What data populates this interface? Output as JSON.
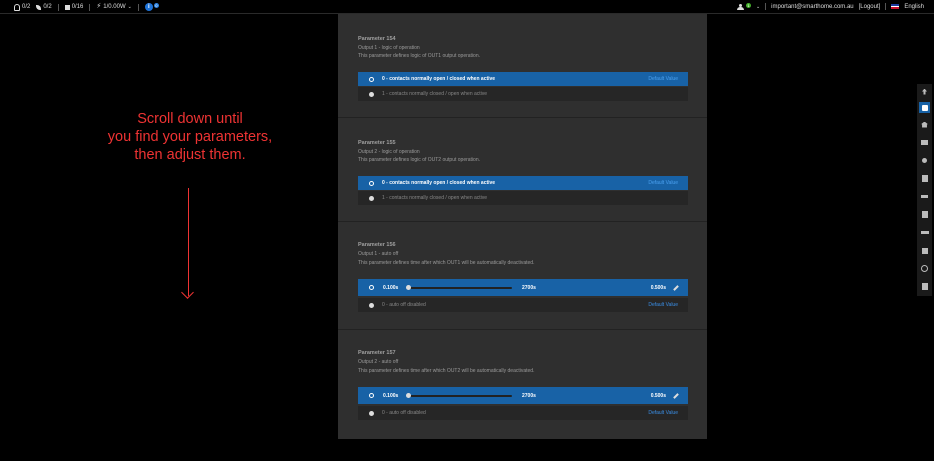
{
  "topbar": {
    "lights": "0/2",
    "plants": "0/2",
    "devices": "0/16",
    "power": "1/0.00W",
    "info_icon": "i",
    "info_badge": "0",
    "user_badge": "1",
    "email": "important@smarthome.com.au",
    "logout": "[Logout]",
    "language": "English"
  },
  "instruction": {
    "line1": "Scroll down until",
    "line2": "you find your parameters,",
    "line3": "then adjust them."
  },
  "parameters": [
    {
      "title": "Parameter 154",
      "subtitle": "Output 1 - logic of operation",
      "description": "This parameter defines logic of OUT1 output operation.",
      "selected_label": "0 - contacts normally open / closed when active",
      "default_label": "Default Value",
      "other_label": "1 - contacts normally closed / open when active"
    },
    {
      "title": "Parameter 155",
      "subtitle": "Output 2 - logic of operation",
      "description": "This parameter defines logic of OUT2 output operation.",
      "selected_label": "0 - contacts normally open / closed when active",
      "default_label": "Default Value",
      "other_label": "1 - contacts normally closed / open when active"
    },
    {
      "title": "Parameter 156",
      "subtitle": "Output 1 - auto off",
      "description": "This parameter defines time after which OUT1 will be automatically deactivated.",
      "slider_min": "0.100s",
      "slider_max": "2700s",
      "slider_value": "0.500s",
      "slider_position": 0.0,
      "other_label": "0 - auto off disabled",
      "default_label": "Default Value"
    },
    {
      "title": "Parameter 157",
      "subtitle": "Output 2 - auto off",
      "description": "This parameter defines time after which OUT2 will be automatically deactivated.",
      "slider_min": "0.100s",
      "slider_max": "2700s",
      "slider_value": "0.500s",
      "slider_position": 0.0,
      "other_label": "0 - auto off disabled",
      "default_label": "Default Value"
    }
  ],
  "side_toolbar": [
    "arrow-up-icon",
    "save-icon",
    "home-icon",
    "chat-icon",
    "marker-icon",
    "clipboard-icon",
    "tools-icon",
    "server-icon",
    "resize-icon",
    "export-icon",
    "location-icon",
    "logout-icon"
  ]
}
